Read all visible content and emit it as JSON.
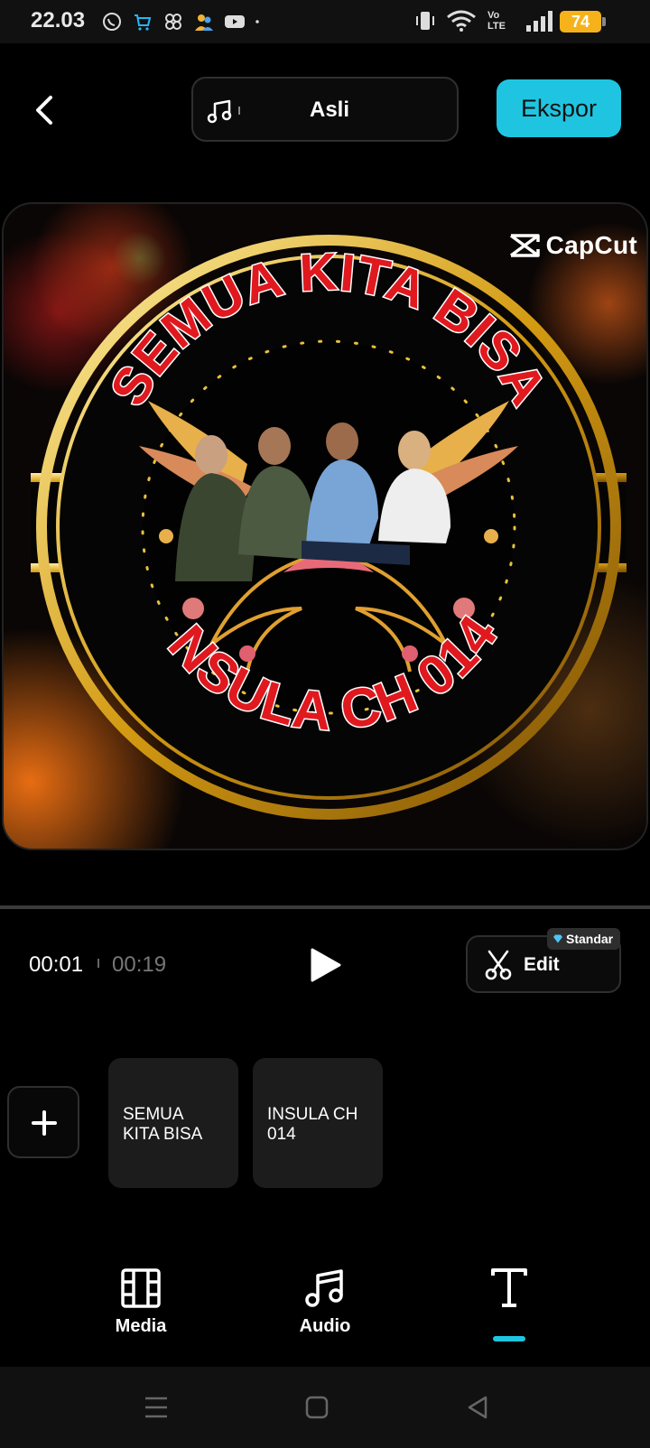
{
  "status_bar": {
    "time": "22.03",
    "network_label": "Vo LTE",
    "battery": "74"
  },
  "header": {
    "audio_label": "Asli",
    "export_label": "Ekspor"
  },
  "preview": {
    "watermark": "CapCut",
    "title_top": "SEMUA KITA BISA",
    "title_bottom": "INSULA CH 014"
  },
  "playback": {
    "current_time": "00:01",
    "total_time": "00:19",
    "edit_label": "Edit",
    "badge_label": "Standar"
  },
  "clips": [
    {
      "text": "SEMUA KITA BISA"
    },
    {
      "text": "INSULA CH 014"
    }
  ],
  "tabs": [
    {
      "label": "Media",
      "icon": "film-icon"
    },
    {
      "label": "Audio",
      "icon": "music-note-icon"
    },
    {
      "label": "",
      "icon": "text-icon"
    }
  ],
  "colors": {
    "accent": "#1fc5e0",
    "background": "#000000",
    "gold": "#e0a21e",
    "red_title": "#e0191f"
  }
}
